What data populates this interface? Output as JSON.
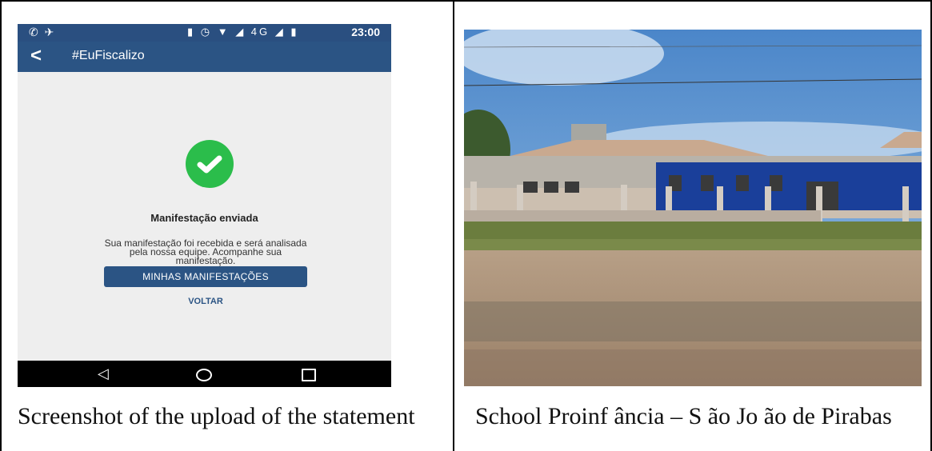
{
  "phone": {
    "status": {
      "left_icons": "✆ ✈",
      "right_icons": "▮ ◷ ▼ ◢ 4G ◢ ▮",
      "time": "23:00"
    },
    "appbar": {
      "back": "<",
      "title": "#EuFiscalizo"
    },
    "message": {
      "title": "Manifestação enviada",
      "body_lines": [
        "Sua manifestação foi recebida e será analisada",
        "pela nossa equipe. Acompanhe sua",
        "manifestação."
      ]
    },
    "primary_button": "MINHAS MANIFESTAÇÕES",
    "link_button": "VOLTAR",
    "nav": {
      "back": "◁"
    }
  },
  "captions": {
    "left": "Screenshot of the upload of the statement",
    "right": "School Proinf ância – S ão Jo ão de Pirabas"
  },
  "colors": {
    "appbar": "#2b5484",
    "success": "#2bbd4b",
    "tile_blue": "#1a3f9a"
  }
}
